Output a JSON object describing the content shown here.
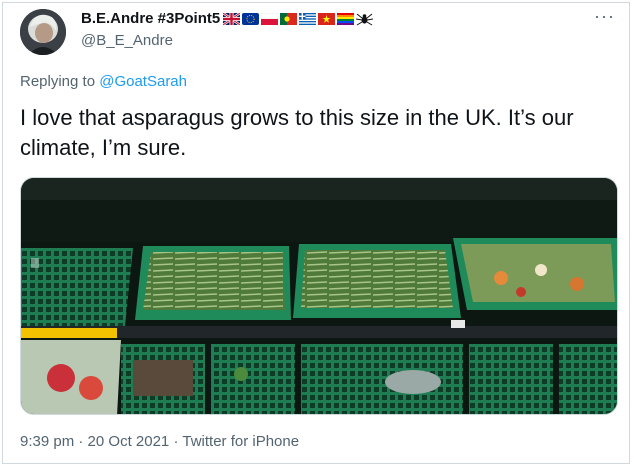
{
  "tweet": {
    "display_name": "B.E.Andre #3Point5",
    "handle": "@B_E_Andre",
    "flags": [
      "uk-flag",
      "eu-flag",
      "poland-flag",
      "portugal-flag",
      "greece-flag",
      "vietnam-flag",
      "rainbow-flag",
      "spider-emoji"
    ],
    "more_label": "···",
    "reply_prefix": "Replying to",
    "reply_to": "@GoatSarah",
    "text": "I love that asparagus grows to this size in the UK. It’s our climate, I’m sure.",
    "time": "9:39 pm",
    "separator1": "·",
    "date": "20 Oct 2021",
    "separator2": "·",
    "source": "Twitter for iPhone"
  },
  "colors": {
    "link": "#1d9bf0",
    "secondary_text": "#536471",
    "crate_green": "#1f8a5a"
  }
}
